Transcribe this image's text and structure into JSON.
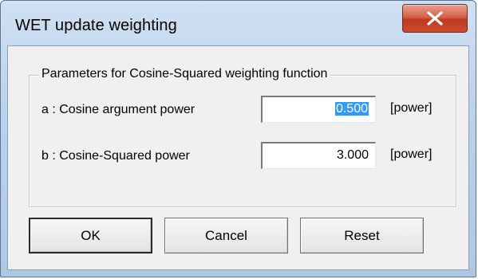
{
  "window": {
    "title": "WET update weighting"
  },
  "titlebar": {
    "close_icon": "close-x-icon"
  },
  "group": {
    "legend": "Parameters for Cosine-Squared weighting function",
    "rows": [
      {
        "label": "a : Cosine argument power",
        "value": "0.500",
        "selected": true,
        "unit": "[power]"
      },
      {
        "label": "b : Cosine-Squared power",
        "value": "3.000",
        "selected": false,
        "unit": "[power]"
      }
    ]
  },
  "buttons": {
    "ok_label": "OK",
    "cancel_label": "Cancel",
    "reset_label": "Reset"
  },
  "colors": {
    "selection_highlight": "#3399ff",
    "close_button": "#c8442a",
    "dialog_face": "#f0f0f0"
  }
}
